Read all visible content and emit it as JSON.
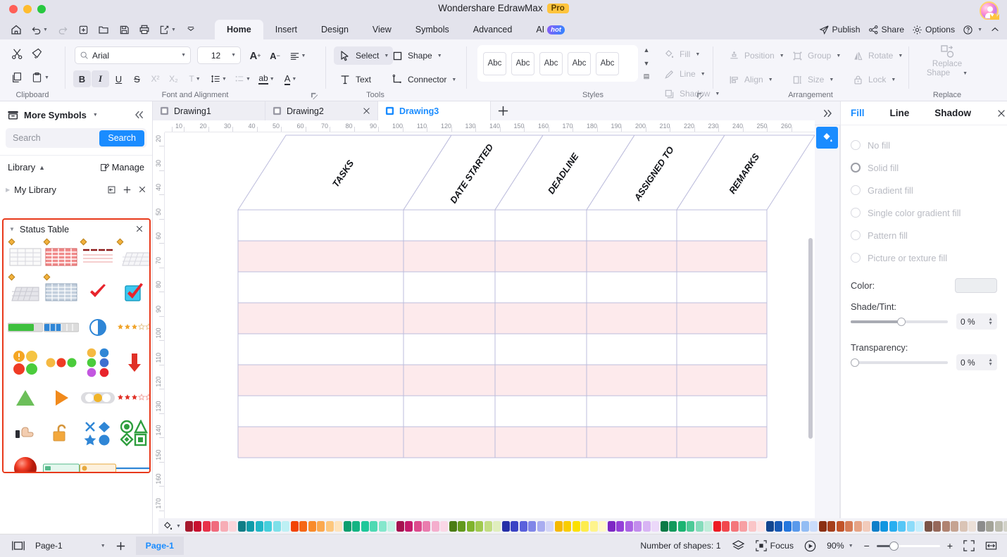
{
  "window": {
    "title": "Wondershare EdrawMax",
    "pro_badge": "Pro"
  },
  "menu": {
    "tabs": [
      {
        "label": "Home",
        "active": true
      },
      {
        "label": "Insert",
        "active": false
      },
      {
        "label": "Design",
        "active": false
      },
      {
        "label": "View",
        "active": false
      },
      {
        "label": "Symbols",
        "active": false
      },
      {
        "label": "Advanced",
        "active": false
      },
      {
        "label": "AI",
        "active": false,
        "badge": "hot"
      }
    ],
    "right_items": [
      {
        "label": "Publish",
        "icon": "publish-icon"
      },
      {
        "label": "Share",
        "icon": "share-icon"
      },
      {
        "label": "Options",
        "icon": "gear-icon"
      }
    ],
    "help_icon": "help-icon",
    "collapse_icon": "chevron-up-icon"
  },
  "quickbar": [
    {
      "icon": "home-icon",
      "name": "home"
    },
    {
      "icon": "undo-icon",
      "name": "undo"
    },
    {
      "icon": "redo-icon",
      "name": "redo"
    },
    {
      "icon": "new-icon",
      "name": "new"
    },
    {
      "icon": "open-icon",
      "name": "open"
    },
    {
      "icon": "save-icon",
      "name": "save"
    },
    {
      "icon": "print-icon",
      "name": "print"
    },
    {
      "icon": "export-icon",
      "name": "export"
    },
    {
      "icon": "more-icon",
      "name": "more"
    }
  ],
  "ribbon": {
    "groups": [
      {
        "label": "Clipboard"
      },
      {
        "label": "Font and Alignment"
      },
      {
        "label": "Tools"
      },
      {
        "label": "Styles"
      },
      {
        "label": "Arrangement"
      },
      {
        "label": "Replace"
      }
    ],
    "font": {
      "family": "Arial",
      "size": "12",
      "grow_label": "A+",
      "shrink_label": "A-",
      "bold": "B",
      "italic": "I",
      "underline": "U",
      "strike": "S",
      "superscript": "X²",
      "subscript": "X₂"
    },
    "tools": {
      "select": "Select",
      "text": "Text",
      "shape": "Shape",
      "connector": "Connector"
    },
    "styles": {
      "samples": [
        "Abc",
        "Abc",
        "Abc",
        "Abc",
        "Abc"
      ],
      "fill": "Fill",
      "line": "Line",
      "shadow": "Shadow"
    },
    "arrangement": {
      "position": "Position",
      "align": "Align",
      "group": "Group",
      "size": "Size",
      "rotate": "Rotate",
      "lock": "Lock"
    },
    "replace": {
      "label_line1": "Replace",
      "label_line2": "Shape"
    }
  },
  "left_panel": {
    "title": "More Symbols",
    "collapse_icon": "chevron-double-left-icon",
    "search": {
      "placeholder": "Search",
      "button": "Search"
    },
    "library_label": "Library",
    "manage_label": "Manage",
    "my_library_label": "My Library",
    "status_table": {
      "title": "Status Table",
      "symbols": [
        {
          "name": "grid-table-plain",
          "pin": true
        },
        {
          "name": "grid-table-red",
          "pin": true
        },
        {
          "name": "line-table-red",
          "pin": true
        },
        {
          "name": "skew-table-light",
          "pin": true
        },
        {
          "name": "skew-table-gray",
          "pin": true
        },
        {
          "name": "grid-table-blue",
          "pin": true
        },
        {
          "name": "check-mark-red",
          "pin": false
        },
        {
          "name": "check-box-blue",
          "pin": false
        },
        {
          "name": "progress-bar-green",
          "pin": false
        },
        {
          "name": "progress-bar-blue",
          "pin": false
        },
        {
          "name": "pie-progress-blue",
          "pin": false
        },
        {
          "name": "star-rating-orange",
          "pin": false
        },
        {
          "name": "traffic-lights-four",
          "pin": false
        },
        {
          "name": "traffic-lights-three",
          "pin": false
        },
        {
          "name": "status-dots-six",
          "pin": false
        },
        {
          "name": "arrow-down-red",
          "pin": false
        },
        {
          "name": "triangle-green",
          "pin": false
        },
        {
          "name": "play-triangle-orange",
          "pin": false
        },
        {
          "name": "signal-lights-bar",
          "pin": false
        },
        {
          "name": "star-rating-red",
          "pin": false
        },
        {
          "name": "hand-pointer",
          "pin": false
        },
        {
          "name": "padlock-open-orange",
          "pin": false
        },
        {
          "name": "shape-set-blue",
          "pin": false
        },
        {
          "name": "shape-set-green",
          "pin": false
        },
        {
          "name": "sphere-red",
          "pin": false
        },
        {
          "name": "slider-bar-green",
          "pin": false
        },
        {
          "name": "slider-bar-orange",
          "pin": false
        },
        {
          "name": "line-blue",
          "pin": false
        }
      ]
    }
  },
  "document_tabs": [
    {
      "label": "Drawing1",
      "active": false,
      "marker": "dot"
    },
    {
      "label": "Drawing2",
      "active": false,
      "marker": "close"
    },
    {
      "label": "Drawing3",
      "active": true,
      "marker": "dot"
    }
  ],
  "new_tab_icon": "plus-icon",
  "rulers": {
    "horizontal": [
      "10",
      "20",
      "30",
      "40",
      "50",
      "60",
      "70",
      "80",
      "90",
      "100",
      "110",
      "120",
      "130",
      "140",
      "150",
      "160",
      "170",
      "180",
      "190",
      "200",
      "210",
      "220",
      "230",
      "240",
      "250",
      "260"
    ],
    "vertical": [
      "20",
      "30",
      "40",
      "50",
      "60",
      "70",
      "80",
      "90",
      "100",
      "110",
      "120",
      "130",
      "140",
      "150",
      "160",
      "170"
    ]
  },
  "canvas": {
    "table": {
      "headers": [
        "TASKS",
        "DATE STARTED",
        "DEADLINE",
        "ASSIGNED TO",
        "REMARKS"
      ],
      "rows": 8,
      "striped_color": "#fdeaec",
      "plain_color": "#ffffff",
      "border_color": "#bcbcdc"
    }
  },
  "right_panel": {
    "tabs": [
      {
        "label": "Fill",
        "active": true
      },
      {
        "label": "Line",
        "active": false
      },
      {
        "label": "Shadow",
        "active": false
      }
    ],
    "close_icon": "close-icon",
    "fill_options": [
      {
        "label": "No fill",
        "selected": false
      },
      {
        "label": "Solid fill",
        "selected": true
      },
      {
        "label": "Gradient fill",
        "selected": false
      },
      {
        "label": "Single color gradient fill",
        "selected": false
      },
      {
        "label": "Pattern fill",
        "selected": false
      },
      {
        "label": "Picture or texture fill",
        "selected": false
      }
    ],
    "color_label": "Color:",
    "color_value": "#eceef1",
    "shade_label": "Shade/Tint:",
    "shade_value": "0 %",
    "transparency_label": "Transparency:",
    "transparency_value": "0 %"
  },
  "palette": {
    "fill_icon": "paint-bucket-icon",
    "colors": [
      "#a6192e",
      "#c8102e",
      "#e8334a",
      "#f06b7d",
      "#f7adb6",
      "#fbd5da",
      "#0f7d86",
      "#0d9ba8",
      "#1fb6c6",
      "#45cfdc",
      "#7ee0e9",
      "#bdf0f4",
      "#f24405",
      "#f56716",
      "#f98b2a",
      "#fba94f",
      "#fdc77d",
      "#fee3bb",
      "#0e9e6e",
      "#14b483",
      "#1ec79a",
      "#4ed9b3",
      "#85e7cc",
      "#c2f3e5",
      "#a5114f",
      "#c41a6b",
      "#dd4b8d",
      "#ea7cae",
      "#f4aecd",
      "#fad7e6",
      "#4a7c14",
      "#62991c",
      "#7fb32c",
      "#a0c94f",
      "#c2dd82",
      "#e0eebd",
      "#2630a8",
      "#3b43c4",
      "#5a61dc",
      "#8086e8",
      "#a9adf0",
      "#d3d5f7",
      "#f5b800",
      "#f9cd00",
      "#fbe000",
      "#fdec4d",
      "#fef48c",
      "#fff9c8",
      "#7d27c4",
      "#9440d8",
      "#ab63e4",
      "#c28ced",
      "#d8b4f4",
      "#ecd9fa",
      "#0b7a46",
      "#12995c",
      "#1cb472",
      "#4dca97",
      "#85dcbb",
      "#c0edda",
      "#ed1c24",
      "#f1484e",
      "#f4767b",
      "#f7a0a4",
      "#fac5c7",
      "#fde4e5",
      "#12458f",
      "#1759b6",
      "#2476dd",
      "#5a9aeb",
      "#93bdf4",
      "#cadcfa",
      "#8b3012",
      "#a53f1c",
      "#c15329",
      "#d67b55",
      "#e6a385",
      "#f2cbbb",
      "#0d7fc9",
      "#1196e0",
      "#28aef0",
      "#56c6f6",
      "#8ddcfa",
      "#c4eefd",
      "#7a5446",
      "#96685a",
      "#b08371",
      "#c5a392",
      "#dac4b6",
      "#ece0d8",
      "#8c8c8c",
      "#a3a398",
      "#bcbcaf",
      "#d2d2c8",
      "#e4e4dd",
      "#f2f2ee",
      "#111111",
      "#2b2b2b",
      "#464646",
      "#606060",
      "#7b7b7b",
      "#979797",
      "#b2b2b2",
      "#cdcdcd",
      "#e3e3e3",
      "#f2f2f2",
      "#fafafa",
      "#ffffff"
    ]
  },
  "statusbar": {
    "view_icon": "page-view-icon",
    "page_select": "Page-1",
    "add_page_icon": "plus-icon",
    "page_chip": "Page-1",
    "shapes_count": "Number of shapes: 1",
    "layers_icon": "layers-icon",
    "focus_label": "Focus",
    "present_icon": "present-icon",
    "zoom_level": "90%",
    "zoom_out": "−",
    "zoom_in": "+",
    "fit_icon": "fit-screen-icon",
    "fit_width_icon": "fit-width-icon"
  }
}
